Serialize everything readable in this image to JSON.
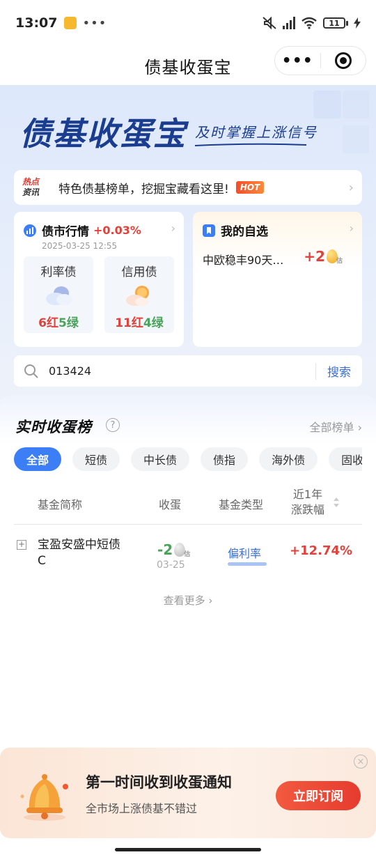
{
  "status_bar": {
    "time": "13:07",
    "more": "•••",
    "battery": "11"
  },
  "nav": {
    "title": "债基收蛋宝",
    "more": "•••"
  },
  "hero": {
    "brand": "债基收蛋宝",
    "slogan": "及时掌握上涨信号"
  },
  "hot_news": {
    "label_top": "热点",
    "label_bottom": "资讯",
    "text": "特色债基榜单，挖掘宝藏看这里!",
    "badge": "HOT",
    "arrow": "›"
  },
  "market": {
    "title": "债市行情",
    "change": "+0.03%",
    "date": "2025-03-25 12:55",
    "arrow": "›",
    "rate_bond": {
      "label": "利率债",
      "red": "6红",
      "green": "5绿"
    },
    "credit_bond": {
      "label": "信用债",
      "red": "11红",
      "green": "4绿"
    }
  },
  "favorites": {
    "title": "我的自选",
    "arrow": "›",
    "item_name": "中欧稳丰90天…",
    "item_value": "+2",
    "est": "估"
  },
  "search": {
    "value": "013424",
    "button": "搜索"
  },
  "ranking": {
    "title": "实时收蛋榜",
    "info": "?",
    "all_link": "全部榜单 ›",
    "tabs": [
      "全部",
      "短债",
      "中长债",
      "债指",
      "海外债",
      "固收+"
    ],
    "columns": {
      "name": "基金简称",
      "egg": "收蛋",
      "type": "基金类型",
      "change_1": "近1年",
      "change_2": "涨跌幅"
    },
    "rows": [
      {
        "expand": "+",
        "name": "宝盈安盛中短债C",
        "egg": "-2",
        "est": "估",
        "date": "03-25",
        "type": "偏利率",
        "change": "+12.74%"
      }
    ],
    "see_more": "查看更多 ›"
  },
  "notification": {
    "title": "第一时间收到收蛋通知",
    "subtitle": "全市场上涨债基不错过",
    "button": "立即订阅",
    "close": "×"
  },
  "colors": {
    "accent_blue": "#3b7ef5",
    "red": "#e0413a",
    "green": "#4aa35a",
    "brand_navy": "#1b3d8f"
  }
}
